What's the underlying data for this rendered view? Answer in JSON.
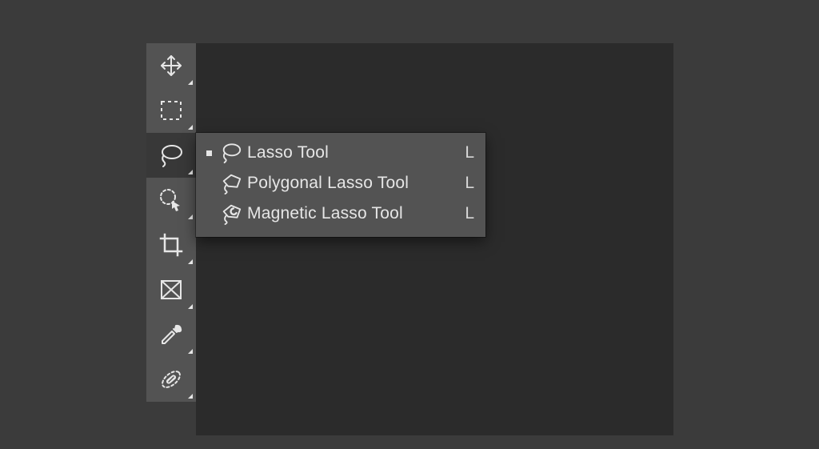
{
  "toolbar": {
    "tools": [
      {
        "id": "move",
        "icon": "move-icon",
        "has_sub": true,
        "selected": false
      },
      {
        "id": "marquee",
        "icon": "marquee-icon",
        "has_sub": true,
        "selected": false
      },
      {
        "id": "lasso",
        "icon": "lasso-icon",
        "has_sub": true,
        "selected": true
      },
      {
        "id": "quick-select",
        "icon": "quick-select-icon",
        "has_sub": true,
        "selected": false
      },
      {
        "id": "crop",
        "icon": "crop-icon",
        "has_sub": true,
        "selected": false
      },
      {
        "id": "frame",
        "icon": "frame-icon",
        "has_sub": true,
        "selected": false
      },
      {
        "id": "eyedropper",
        "icon": "eyedropper-icon",
        "has_sub": true,
        "selected": false
      },
      {
        "id": "healing",
        "icon": "healing-icon",
        "has_sub": true,
        "selected": false
      }
    ]
  },
  "flyout": {
    "items": [
      {
        "icon": "lasso-icon",
        "label": "Lasso Tool",
        "shortcut": "L",
        "active": true
      },
      {
        "icon": "polygonal-lasso-icon",
        "label": "Polygonal Lasso Tool",
        "shortcut": "L",
        "active": false
      },
      {
        "icon": "magnetic-lasso-icon",
        "label": "Magnetic Lasso Tool",
        "shortcut": "L",
        "active": false
      }
    ]
  },
  "colors": {
    "bg": "#3b3b3b",
    "panel": "#535353",
    "panel_dark": "#383838",
    "canvas": "#2b2b2b",
    "fg": "#e6e6e6"
  }
}
